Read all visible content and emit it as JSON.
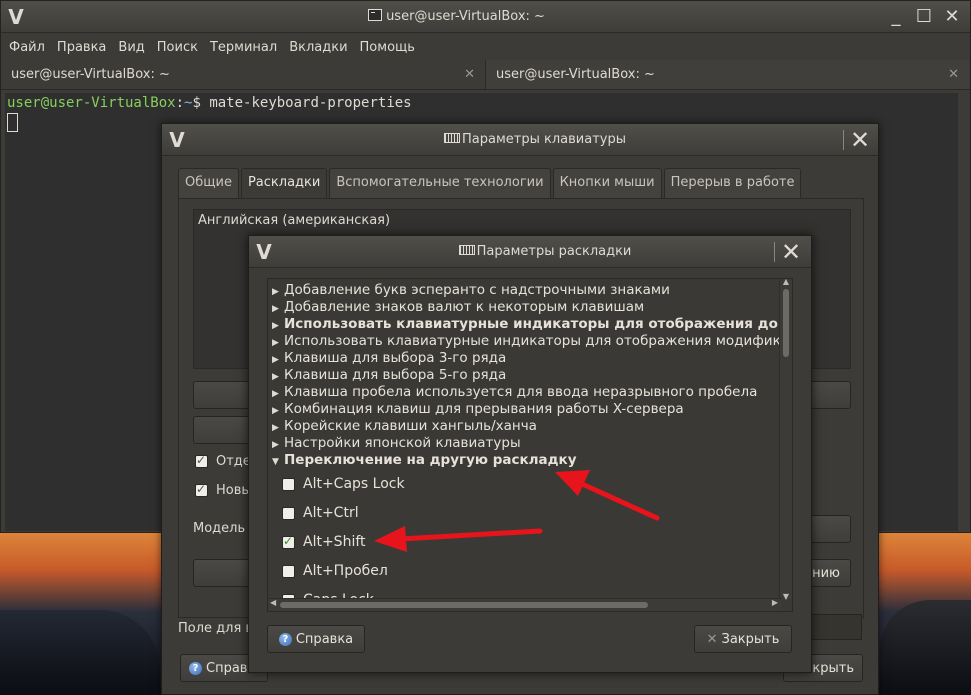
{
  "terminal": {
    "title": "user@user-VirtualBox: ~",
    "menu": [
      "Файл",
      "Правка",
      "Вид",
      "Поиск",
      "Терминал",
      "Вкладки",
      "Помощь"
    ],
    "tabs": [
      {
        "label": "user@user-VirtualBox: ~",
        "close": "✕"
      },
      {
        "label": "user@user-VirtualBox: ~",
        "close": "✕"
      }
    ],
    "prompt_user": "user@user-VirtualBox",
    "prompt_sep": ":",
    "prompt_path": "~",
    "prompt_dollar": "$",
    "command": " mate-keyboard-properties",
    "controls": {
      "minimize": "_",
      "maximize": "☐",
      "close": "✕"
    }
  },
  "kbd_dialog": {
    "title": "Параметры клавиатуры",
    "tabs": [
      "Общие",
      "Раскладки",
      "Вспомогательные технологии",
      "Кнопки мыши",
      "Перерыв в работе"
    ],
    "active_tab": "Раскладки",
    "layout_item": "Английская (американская)",
    "checkbox_1": "Отде",
    "checkbox_2": "Новы",
    "model_label": "Модель",
    "reset_btn_partial": "нию",
    "field_label": "Поле для в",
    "help_label_partial": "Справ",
    "close_label_partial": "крыть",
    "close_glyph": "✕"
  },
  "opt_dialog": {
    "title": "Параметры раскладки",
    "close_glyph": "✕",
    "tree_items": [
      {
        "label": "Добавление букв эсперанто с надстрочными знаками",
        "bold": false
      },
      {
        "label": "Добавление знаков валют к некоторым клавишам",
        "bold": false
      },
      {
        "label": "Использовать клавиатурные индикаторы для отображения допол",
        "bold": true
      },
      {
        "label": "Использовать клавиатурные индикаторы для отображения модифика",
        "bold": false
      },
      {
        "label": "Клавиша для выбора 3-го ряда",
        "bold": false
      },
      {
        "label": "Клавиша для выбора 5-го ряда",
        "bold": false
      },
      {
        "label": "Клавиша пробела используется для ввода неразрывного пробела",
        "bold": false
      },
      {
        "label": "Комбинация клавиш для прерывания работы X-сервера",
        "bold": false
      },
      {
        "label": "Корейские клавиши хангыль/ханча",
        "bold": false
      },
      {
        "label": "Настройки японской клавиатуры",
        "bold": false
      }
    ],
    "expanded_item": "Переключение на другую раскладку",
    "options": [
      {
        "label": "Alt+Caps Lock",
        "checked": false
      },
      {
        "label": "Alt+Ctrl",
        "checked": false
      },
      {
        "label": "Alt+Shift",
        "checked": true
      },
      {
        "label": "Alt+Пробел",
        "checked": false
      },
      {
        "label": "Caps Lock",
        "checked": false
      }
    ],
    "help_label": "Справка",
    "close_label": "Закрыть",
    "help_glyph": "?"
  },
  "colors": {
    "annotation_arrow": "#e8141b",
    "checkbox_check": "#3f8a32"
  }
}
